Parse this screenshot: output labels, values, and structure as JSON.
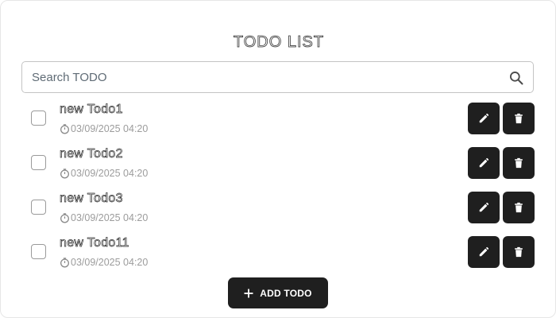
{
  "header": {
    "title": "TODO LIST"
  },
  "search": {
    "placeholder": "Search TODO",
    "value": ""
  },
  "todos": [
    {
      "title": "new Todo1",
      "date": "03/09/2025 04:20",
      "checked": false
    },
    {
      "title": "new Todo2",
      "date": "03/09/2025 04:20",
      "checked": false
    },
    {
      "title": "new Todo3",
      "date": "03/09/2025 04:20",
      "checked": false
    },
    {
      "title": "new Todo11",
      "date": "03/09/2025 04:20",
      "checked": false
    }
  ],
  "actions": {
    "add_label": "ADD TODO"
  },
  "icons": {
    "search": "search-icon",
    "clock": "clock-icon",
    "edit": "pencil-icon",
    "delete": "trash-icon",
    "add": "plus-icon"
  },
  "colors": {
    "button_bg": "#1f1f1f",
    "button_fg": "#ffffff",
    "date_text": "#9c9c9c"
  }
}
